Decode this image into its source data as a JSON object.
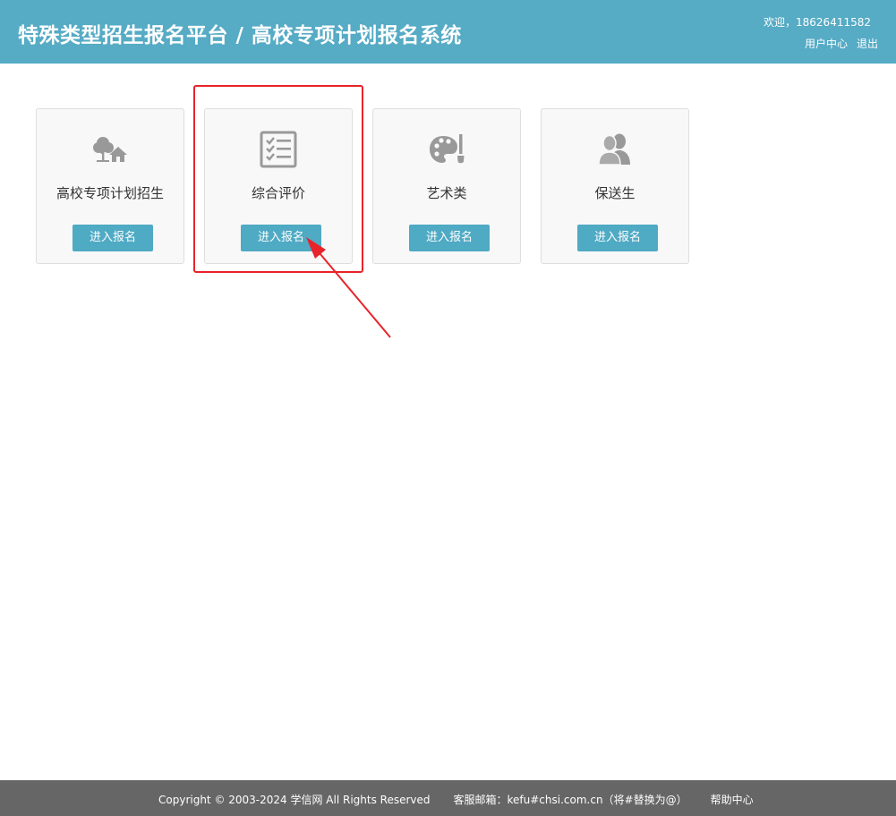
{
  "header": {
    "title": "特殊类型招生报名平台 / 高校专项计划报名系统",
    "welcome": "欢迎，18626411582",
    "user_center": "用户中心",
    "logout": "退出",
    "bg_color": "#56abc5"
  },
  "cards": [
    {
      "icon": "tree-house-icon",
      "label": "高校专项计划招生",
      "button": "进入报名"
    },
    {
      "icon": "checklist-icon",
      "label": "综合评价",
      "button": "进入报名"
    },
    {
      "icon": "palette-icon",
      "label": "艺术类",
      "button": "进入报名"
    },
    {
      "icon": "users-icon",
      "label": "保送生",
      "button": "进入报名"
    }
  ],
  "annotation": {
    "highlight_color": "#e8232a"
  },
  "footer": {
    "copyright": "Copyright © 2003-2024 学信网 All Rights Reserved",
    "email": "客服邮箱：kefu#chsi.com.cn（将#替换为@）",
    "help": "帮助中心"
  }
}
